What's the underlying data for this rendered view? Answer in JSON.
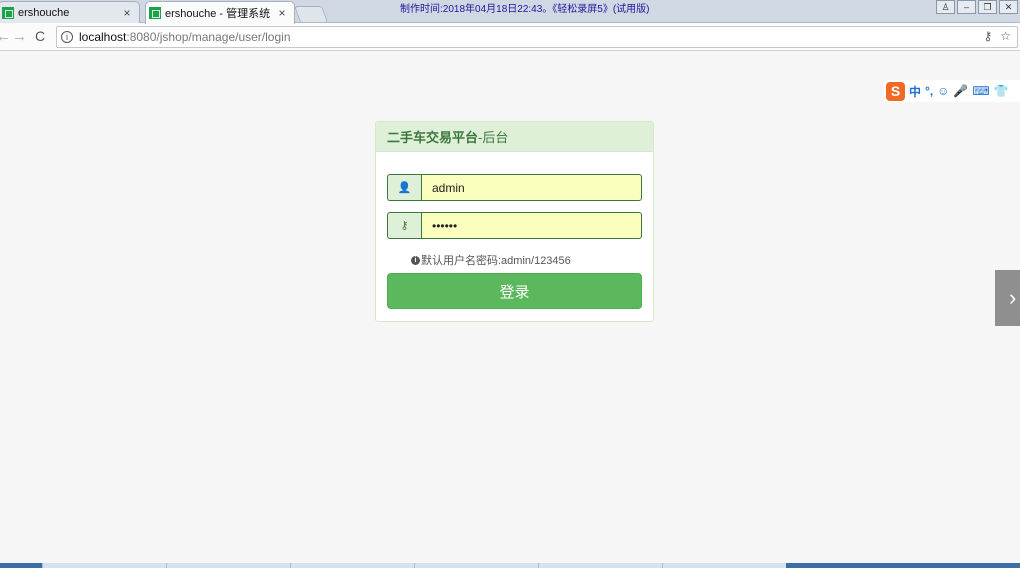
{
  "browser": {
    "tabs": [
      {
        "title": "ershouche",
        "close": "×"
      },
      {
        "title": "ershouche - 管理系统",
        "close": "×"
      }
    ],
    "watermark": "制作时间:2018年04月18日22:43。《轻松录屏5》(试用版)",
    "window_buttons": [
      "♙",
      "–",
      "❐",
      "✕"
    ],
    "nav": {
      "back": "←",
      "forward": "→",
      "reload": "C"
    },
    "address": {
      "host": "localhost",
      "path": ":8080/jshop/manage/user/login"
    },
    "omni_icons": {
      "key": "⚷",
      "star": "☆"
    }
  },
  "ime": {
    "logo": "S",
    "lang": "中",
    "items": [
      "°,",
      "☺",
      "🎤",
      "⌨",
      "👕"
    ]
  },
  "side_arrow": "›",
  "login": {
    "title_bold": "二手车交易平台",
    "title_rest": "-后台",
    "username_value": "admin",
    "password_value": "••••••",
    "hint_icon": "i",
    "hint": "默认用户名密码:admin/123456",
    "submit_label": "登录",
    "user_icon": "👤",
    "key_icon": "⚷"
  },
  "colors": {
    "panel_border": "#d6e9c6",
    "panel_heading_bg": "#dff0d8",
    "heading_text": "#3c763d",
    "autofill_bg": "#faffbd",
    "button_green": "#5cb85c"
  }
}
